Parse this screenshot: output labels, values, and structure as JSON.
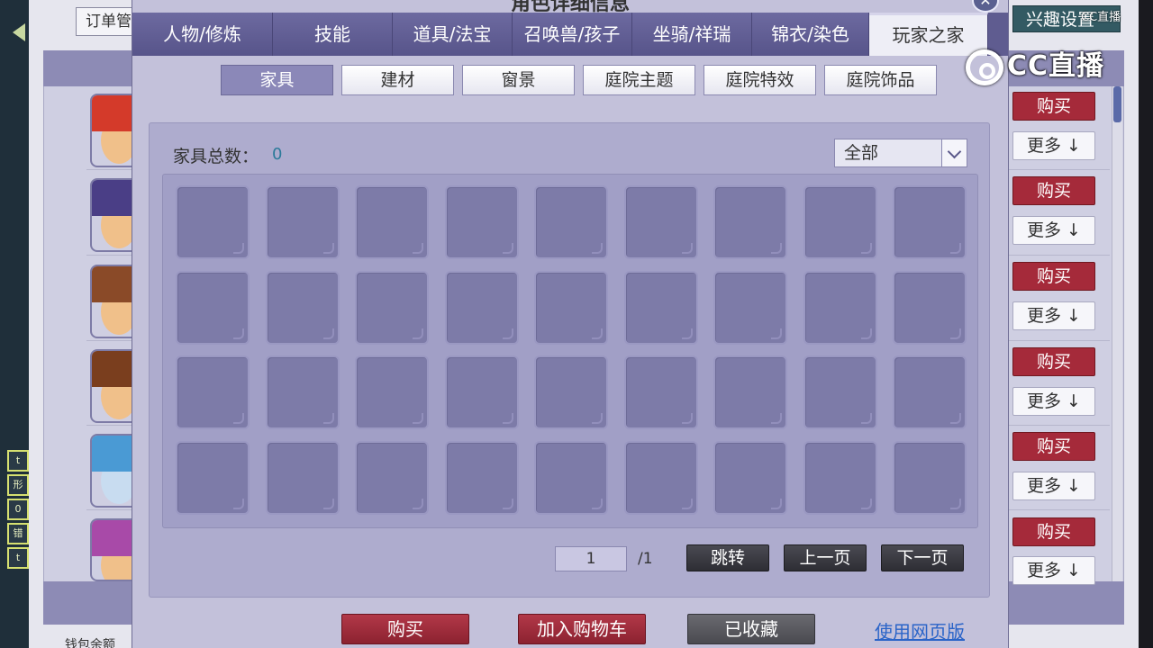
{
  "background": {
    "order_label": "订单管",
    "interest_button": "兴趣设置",
    "rows": [
      {
        "buy_label": "购买",
        "more_label": "更多 ↓"
      },
      {
        "buy_label": "购买",
        "more_label": "更多 ↓"
      },
      {
        "buy_label": "购买",
        "more_label": "更多 ↓"
      },
      {
        "buy_label": "购买",
        "more_label": "更多 ↓"
      },
      {
        "buy_label": "购买",
        "more_label": "更多 ↓"
      },
      {
        "buy_label": "购买",
        "more_label": "更多 ↓"
      }
    ],
    "left_badges": [
      "t",
      "形",
      "0",
      "错",
      "t"
    ],
    "bottom_text": "钱包余额"
  },
  "watermark": {
    "brand": "CC直播",
    "small": "CC直播"
  },
  "dialog": {
    "title": "角色详细信息",
    "close_glyph": "✕",
    "main_tabs": [
      {
        "label": "人物/修炼",
        "active": false
      },
      {
        "label": "技能",
        "active": false
      },
      {
        "label": "道具/法宝",
        "active": false
      },
      {
        "label": "召唤兽/孩子",
        "active": false
      },
      {
        "label": "坐骑/祥瑞",
        "active": false
      },
      {
        "label": "锦衣/染色",
        "active": false
      },
      {
        "label": "玩家之家",
        "active": true
      }
    ],
    "sub_tabs": [
      {
        "label": "家具",
        "active": true
      },
      {
        "label": "建材",
        "active": false
      },
      {
        "label": "窗景",
        "active": false
      },
      {
        "label": "庭院主题",
        "active": false
      },
      {
        "label": "庭院特效",
        "active": false
      },
      {
        "label": "庭院饰品",
        "active": false
      }
    ],
    "furniture_count_label": "家具总数：",
    "furniture_count": "0",
    "filter_value": "全部",
    "slot_count": 36,
    "pager": {
      "current_page": "1",
      "total_pages": "/1",
      "jump_label": "跳转",
      "prev_label": "上一页",
      "next_label": "下一页"
    },
    "actions": {
      "buy_label": "购买",
      "add_cart_label": "加入购物车",
      "favorited_label": "已收藏",
      "web_link_label": "使用网页版"
    }
  },
  "colors": {
    "accent_red": "#a52a3a",
    "tab_purple": "#5f5c90",
    "panel_bg": "#aeacce",
    "slot_bg": "#7d7ba8",
    "link_blue": "#2a64c8"
  }
}
